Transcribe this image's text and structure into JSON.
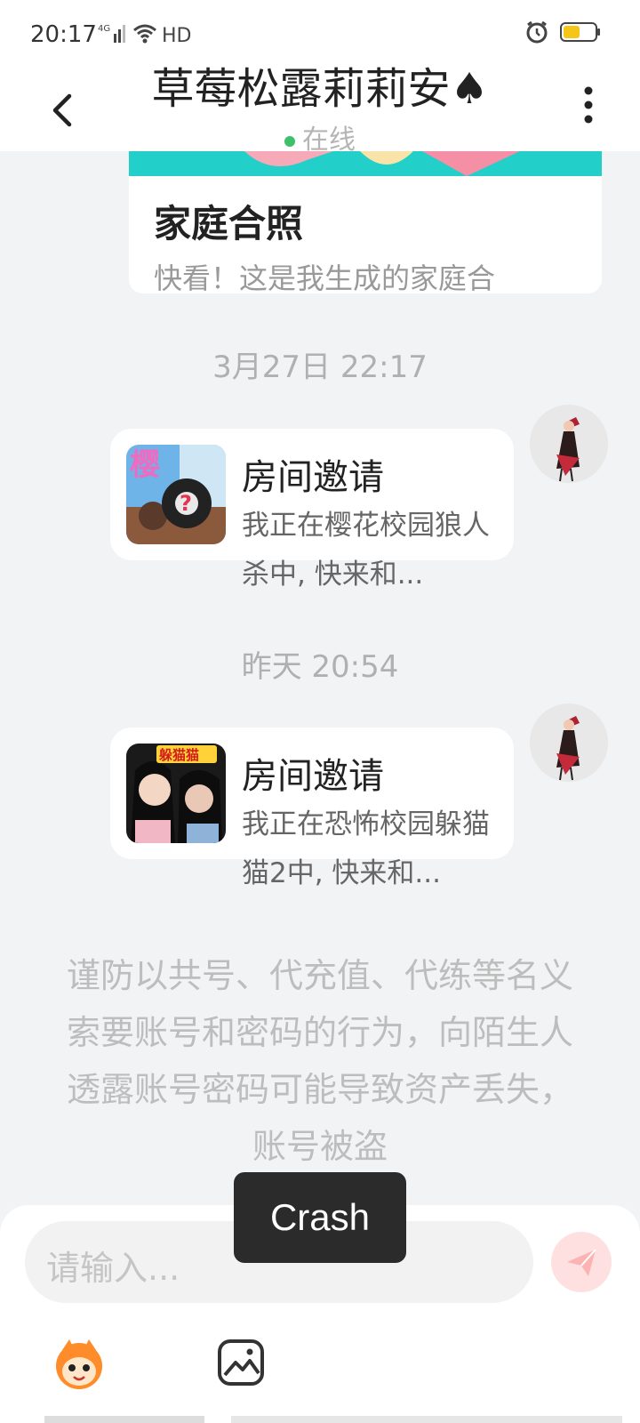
{
  "status_bar": {
    "time": "20:17",
    "network": "4G",
    "hd": "HD"
  },
  "header": {
    "title": "草莓松露莉莉安♠",
    "status": "在线"
  },
  "prev_card": {
    "title": "家庭合照",
    "desc": "快看！这是我生成的家庭合"
  },
  "messages": [
    {
      "timestamp": "3月27日 22:17",
      "title": "房间邀请",
      "desc": "我正在樱花校园狼人杀中, 快来和...",
      "thumb_label": "樱",
      "thumb_mark": "?"
    },
    {
      "timestamp": "昨天 20:54",
      "title": "房间邀请",
      "desc": "我正在恐怖校园躲猫猫2中, 快来和...",
      "thumb_label": "躲猫猫"
    }
  ],
  "warning": "谨防以共号、代充值、代练等名义索要账号和密码的行为，向陌生人透露账号密码可能导致资产丢失，账号被盗",
  "input": {
    "placeholder": "请输入..."
  },
  "toast": "Crash",
  "colors": {
    "online": "#3ec06a",
    "card_accent": "#23cfc9",
    "send_button": "#ffe0e0"
  }
}
